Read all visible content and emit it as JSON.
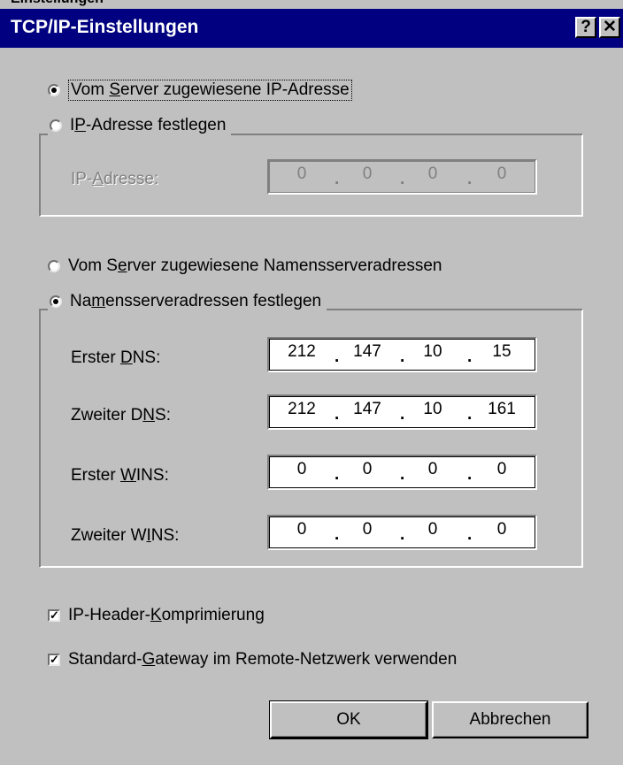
{
  "caption_strip_text": "Einstellungen",
  "window": {
    "title": "TCP/IP-Einstellungen",
    "help_label": "?",
    "close_label": "✕"
  },
  "ip_section": {
    "radio_server": {
      "pre": "Vom ",
      "accel": "S",
      "post": "erver zugewiesene IP-Adresse",
      "checked": true
    },
    "radio_fixed": {
      "pre": "I",
      "accel": "P",
      "post": "-Adresse festlegen",
      "checked": false
    },
    "ip_label": {
      "pre": "IP-",
      "accel": "A",
      "post": "dresse:"
    },
    "ip_octets": [
      "0",
      "0",
      "0",
      "0"
    ]
  },
  "dns_section": {
    "radio_server": {
      "pre": "Vom S",
      "accel": "e",
      "post": "rver zugewiesene Namensserveradressen",
      "checked": false
    },
    "radio_fixed": {
      "pre": "Na",
      "accel": "m",
      "post": "ensserveradressen festlegen",
      "checked": true
    },
    "fields": [
      {
        "pre": "Erster ",
        "accel": "D",
        "post": "NS:",
        "octets": [
          "212",
          "147",
          "10",
          "15"
        ]
      },
      {
        "pre": "Zweiter D",
        "accel": "N",
        "post": "S:",
        "octets": [
          "212",
          "147",
          "10",
          "161"
        ]
      },
      {
        "pre": "Erster ",
        "accel": "W",
        "post": "INS:",
        "octets": [
          "0",
          "0",
          "0",
          "0"
        ]
      },
      {
        "pre": "Zweiter W",
        "accel": "I",
        "post": "NS:",
        "octets": [
          "0",
          "0",
          "0",
          "0"
        ]
      }
    ]
  },
  "checkboxes": {
    "compression": {
      "pre": "IP-Header-",
      "accel": "K",
      "post": "omprimierung",
      "checked": true
    },
    "gateway": {
      "pre": "Standard-",
      "accel": "G",
      "post": "ateway im Remote-Netzwerk verwenden",
      "checked": true
    }
  },
  "buttons": {
    "ok": "OK",
    "cancel": "Abbrechen"
  },
  "colors": {
    "titlebar": "#000080",
    "face": "#c0c0c0",
    "disabled_text": "#808080"
  }
}
